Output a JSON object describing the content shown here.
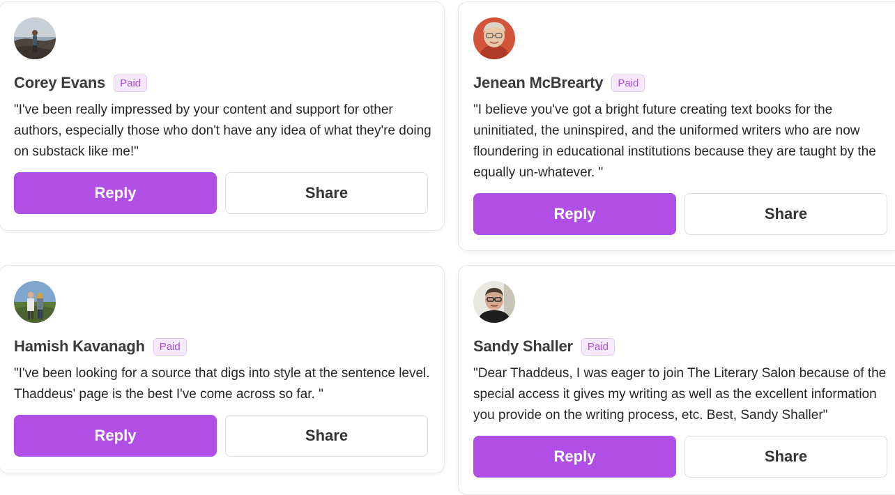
{
  "theme": {
    "accent": "#b04ee6",
    "badge_text": "#a64fd8",
    "badge_bg": "#f6e9fd"
  },
  "testimonials": [
    {
      "name": "Corey Evans",
      "badge": "Paid",
      "quote": "\"I've been really impressed by your content and support for other authors, especially those who don't have any idea of what they're doing on substack like me!\"",
      "reply_label": "Reply",
      "share_label": "Share"
    },
    {
      "name": "Jenean McBrearty",
      "badge": "Paid",
      "quote": "\"I believe you've got a bright future creating text books for the uninitiated, the uninspired, and the uniformed writers who are now floundering in educational institutions because they are taught by the equally un-whatever. \"",
      "reply_label": "Reply",
      "share_label": "Share"
    },
    {
      "name": "Hamish Kavanagh",
      "badge": "Paid",
      "quote": "\"I've been looking for a source that digs into style at the sentence level. Thaddeus' page is the best I've come across so far. \"",
      "reply_label": "Reply",
      "share_label": "Share"
    },
    {
      "name": "Sandy Shaller",
      "badge": "Paid",
      "quote": "\"Dear Thaddeus, I was eager to join The Literary Salon because of the special access it gives my writing as well as the excellent information you provide on the writing process, etc. Best, Sandy Shaller\"",
      "reply_label": "Reply",
      "share_label": "Share"
    }
  ]
}
